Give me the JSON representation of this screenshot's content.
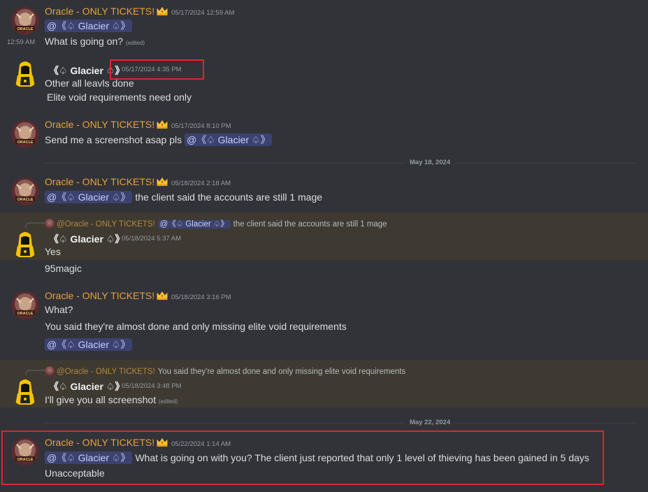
{
  "messages": {
    "m1": {
      "author": "Oracle - ONLY TICKETS!",
      "timestamp": "05/17/2024 12:59 AM",
      "mention": "@《♤ Glacier ♤》"
    },
    "m1b": {
      "hover_time": "12:59 AM",
      "text": "What is going on?",
      "edited": "(edited)"
    },
    "m2": {
      "author": "《♤ Glacier ♤》",
      "timestamp": "05/17/2024 4:35 PM",
      "line1": "Other all leavls done",
      "line2": "Elite void requirements need only"
    },
    "m3": {
      "author": "Oracle - ONLY TICKETS!",
      "timestamp": "05/17/2024 8:10 PM",
      "text": "Send me a screenshot asap pls",
      "mention": "@《♤ Glacier ♤》"
    },
    "m4": {
      "author": "Oracle - ONLY TICKETS!",
      "timestamp": "05/18/2024 2:18 AM",
      "mention": "@《♤ Glacier ♤》",
      "text": "the client said the accounts are still 1 mage"
    },
    "m5": {
      "reply_author": "@Oracle - ONLY TICKETS!",
      "reply_mention": "@《♤ Glacier ♤》",
      "reply_text": "the client said the accounts are still 1 mage",
      "author": "《♤ Glacier ♤》",
      "timestamp": "05/18/2024 5:37 AM",
      "line1": "Yes",
      "line2": "95magic"
    },
    "m6": {
      "author": "Oracle - ONLY TICKETS!",
      "timestamp": "05/18/2024 3:16 PM",
      "line1": "What?",
      "line2": "You said they're almost done and only missing elite void requirements",
      "mention": "@《♤ Glacier ♤》"
    },
    "m7": {
      "reply_author": "@Oracle - ONLY TICKETS!",
      "reply_text": "You said they're almost done and only missing elite void requirements",
      "author": "《♤ Glacier ♤》",
      "timestamp": "05/18/2024 3:48 PM",
      "text": "I'll give you all screenshot",
      "edited": "(edited)"
    },
    "m8": {
      "author": "Oracle - ONLY TICKETS!",
      "timestamp": "05/22/2024 1:14 AM",
      "mention": "@《♤ Glacier ♤》",
      "text": "What is going on with you? The client just reported that only 1 level of thieving has been gained in 5 days",
      "line2": "Unacceptable"
    }
  },
  "dividers": {
    "d1": "May 18, 2024",
    "d2": "May 22, 2024"
  },
  "avatar_labels": {
    "oracle": "ORACLE"
  },
  "colors": {
    "background": "#313338",
    "oracle_name": "#e6a044",
    "mention_bg": "#3c4270",
    "mention_text": "#c9cdfb",
    "highlight": "#e0252f",
    "reply_bg": "#3e3a31"
  },
  "icons": {
    "crown": "crown-icon",
    "oracle_avatar": "oracle-avatar",
    "glacier_avatar": "hooded-figure-avatar"
  }
}
